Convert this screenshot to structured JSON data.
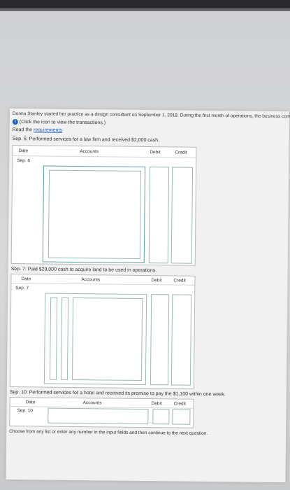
{
  "intro": "Donna Stanley started her practice as a design consultant on September 1, 2018. During the first month of operations, the business completed the following transactions:",
  "click_icon": "(Click the icon to view the transactions.)",
  "requirements_prefix": "Read the",
  "requirements_link": "requirements",
  "tables": [
    {
      "title": "Sep. 6: Performed services for a law firm and received $2,000 cash.",
      "headers": {
        "date": "Date",
        "accounts": "Accounts",
        "debit": "Debit",
        "credit": "Credit"
      },
      "row_label": "Sep. 6"
    },
    {
      "title": "Sep. 7: Paid $29,000 cash to acquire land to be used in operations.",
      "headers": {
        "date": "Date",
        "accounts": "Accounts",
        "debit": "Debit",
        "credit": "Credit"
      },
      "row_label": "Sep. 7"
    },
    {
      "title": "Sep. 10: Performed services for a hotel and received its promise to pay the $1,100 within one week.",
      "headers": {
        "date": "Date",
        "accounts": "Accounts",
        "debit": "Debit",
        "credit": "Credit"
      },
      "row_label": "Sep. 10"
    }
  ],
  "footer": "Choose from any list or enter any number in the input fields and then continue to the next question."
}
